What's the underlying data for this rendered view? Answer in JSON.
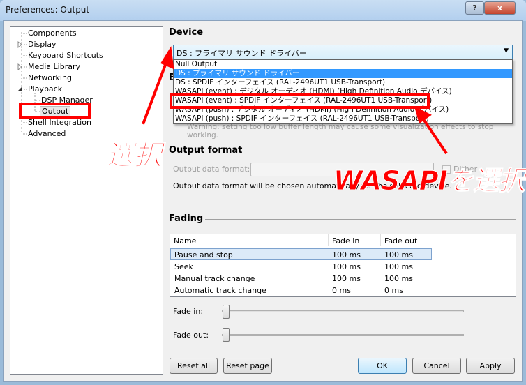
{
  "window": {
    "title": "Preferences: Output",
    "help": "?",
    "close": "x"
  },
  "tree": [
    "Components",
    "Display",
    "Keyboard Shortcuts",
    "Media Library",
    "Networking",
    "Playback",
    "DSP Manager",
    "Output",
    "Shell Integration",
    "Advanced"
  ],
  "device": {
    "header": "Device",
    "selected": "DS : プライマリ サウンド ドライバー",
    "options": [
      "Null Output",
      "DS : プライマリ サウンド ドライバー",
      "DS : SPDIF インターフェイス (RAL-2496UT1 USB-Transport)",
      "WASAPI (event) : デジタル オーディオ (HDMI) (High Definition Audio デバイス)",
      "WASAPI (event) : SPDIF インターフェイス (RAL-2496UT1 USB-Transport)",
      "WASAPI (push) : デジタル オーディオ (HDMI) (High Definition Audio デバイス)",
      "WASAPI (push) : SPDIF インターフェイス (RAL-2496UT1 USB-Transport)"
    ],
    "buffer_header": "B",
    "warning": "Warning: setting too low buffer length may cause some visualization effects to stop working."
  },
  "output_format": {
    "header": "Output format",
    "label": "Output data format:",
    "dither": "Dither",
    "note": "Output data format will be chosen automatically for the selected device."
  },
  "fading": {
    "header": "Fading",
    "columns": [
      "Name",
      "Fade in",
      "Fade out"
    ],
    "rows": [
      [
        "Pause and stop",
        "100 ms",
        "100 ms"
      ],
      [
        "Seek",
        "100 ms",
        "100 ms"
      ],
      [
        "Manual track change",
        "100 ms",
        "100 ms"
      ],
      [
        "Automatic track change",
        "0 ms",
        "0 ms"
      ]
    ],
    "fade_in_label": "Fade in:",
    "fade_out_label": "Fade out:",
    "fade_in_value": 0,
    "fade_out_value": 0
  },
  "buttons": {
    "reset_all": "Reset all",
    "reset_page": "Reset page",
    "ok": "OK",
    "cancel": "Cancel",
    "apply": "Apply"
  },
  "annotations": {
    "left": "選択",
    "right": "WASAPIを選択"
  }
}
